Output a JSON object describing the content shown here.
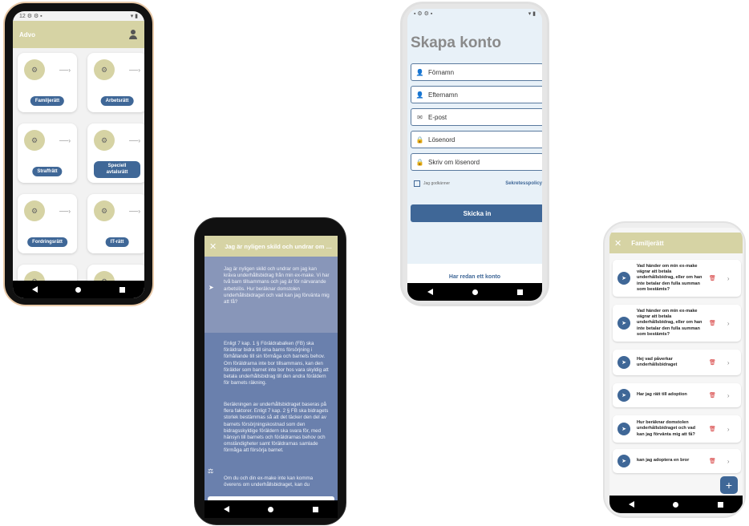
{
  "app": {
    "name": "Advo",
    "categories": [
      {
        "label": "Familjerätt"
      },
      {
        "label": "Arbetsrätt"
      },
      {
        "label": "Straffrätt"
      },
      {
        "label": "Speciell avtalsrätt"
      },
      {
        "label": "Fordringsrätt"
      },
      {
        "label": "IT-rätt"
      },
      {
        "label": ""
      },
      {
        "label": ""
      }
    ]
  },
  "chat": {
    "title": "Jag är nyligen skild och undrar om jag kan kräva underhållsbidrag",
    "user_message": "Jag är nyligen skild och undrar om jag kan kräva underhållsbidrag från min ex-make. Vi har två barn tillsammans och jag är för närvarande arbetslös. Hur beräknar domstolen underhållsbidraget och vad kan jag förvänta mig att få?",
    "bot_message_p1": "Enligt 7 kap. 1 § Föräldrabalken (FB) ska föräldrar bidra till sina barns försörjning i förhållande till sin förmåga och barnets behov. Om föräldrarna inte bor tillsammans, kan den förälder som barnet inte bor hos vara skyldig att betala underhållsbidrag till den andra föräldern för barnets räkning.",
    "bot_message_p2": "Beräkningen av underhållsbidraget baseras på flera faktorer. Enligt 7 kap. 2 § FB ska bidragets storlek bestämmas så att det täcker den del av barnets försörjningskostnad som den bidragsskyldige föräldern ska svara för, med hänsyn till barnets och föräldrarnas behov och omständigheter samt föräldrarnas samlade förmåga att försörja barnet.",
    "bot_message_p3": "Om du och din ex-make inte kan komma överens om underhållsbidraget, kan du",
    "input_value": "?"
  },
  "signup": {
    "title": "Skapa konto",
    "fields": {
      "first_name": "Förnamn",
      "last_name": "Efternamn",
      "email": "E-post",
      "password": "Lösenord",
      "password_repeat": "Skriv om lösenord"
    },
    "consent_label": "Jag godkänner",
    "policy_link": "Sekretesspolicy",
    "submit": "Skicka in",
    "existing_account": "Har redan ett konto"
  },
  "history": {
    "title": "Familjerätt",
    "questions": [
      "Vad händer om min ex-make vägrar att betala underhållsbidrag, eller om han inte betalar den fulla summan som bestämts?",
      "Vad händer om min ex-make vägrar att betala underhållsbidrag, eller om han inte betalar den fulla summan som bestämts?",
      "Hej vad påverkar underhållsbidraget",
      "Har jag rätt till adoption",
      "Hur beräknar domstolen underhållsbidraget och vad kan jag förvänta mig att få?",
      "kan jag adoptera en bror"
    ]
  },
  "colors": {
    "header_khaki": "#d6d3a4",
    "primary_blue": "#3f6797",
    "chat_bg": "#6a80ad",
    "delete_red": "#d32f2f"
  }
}
